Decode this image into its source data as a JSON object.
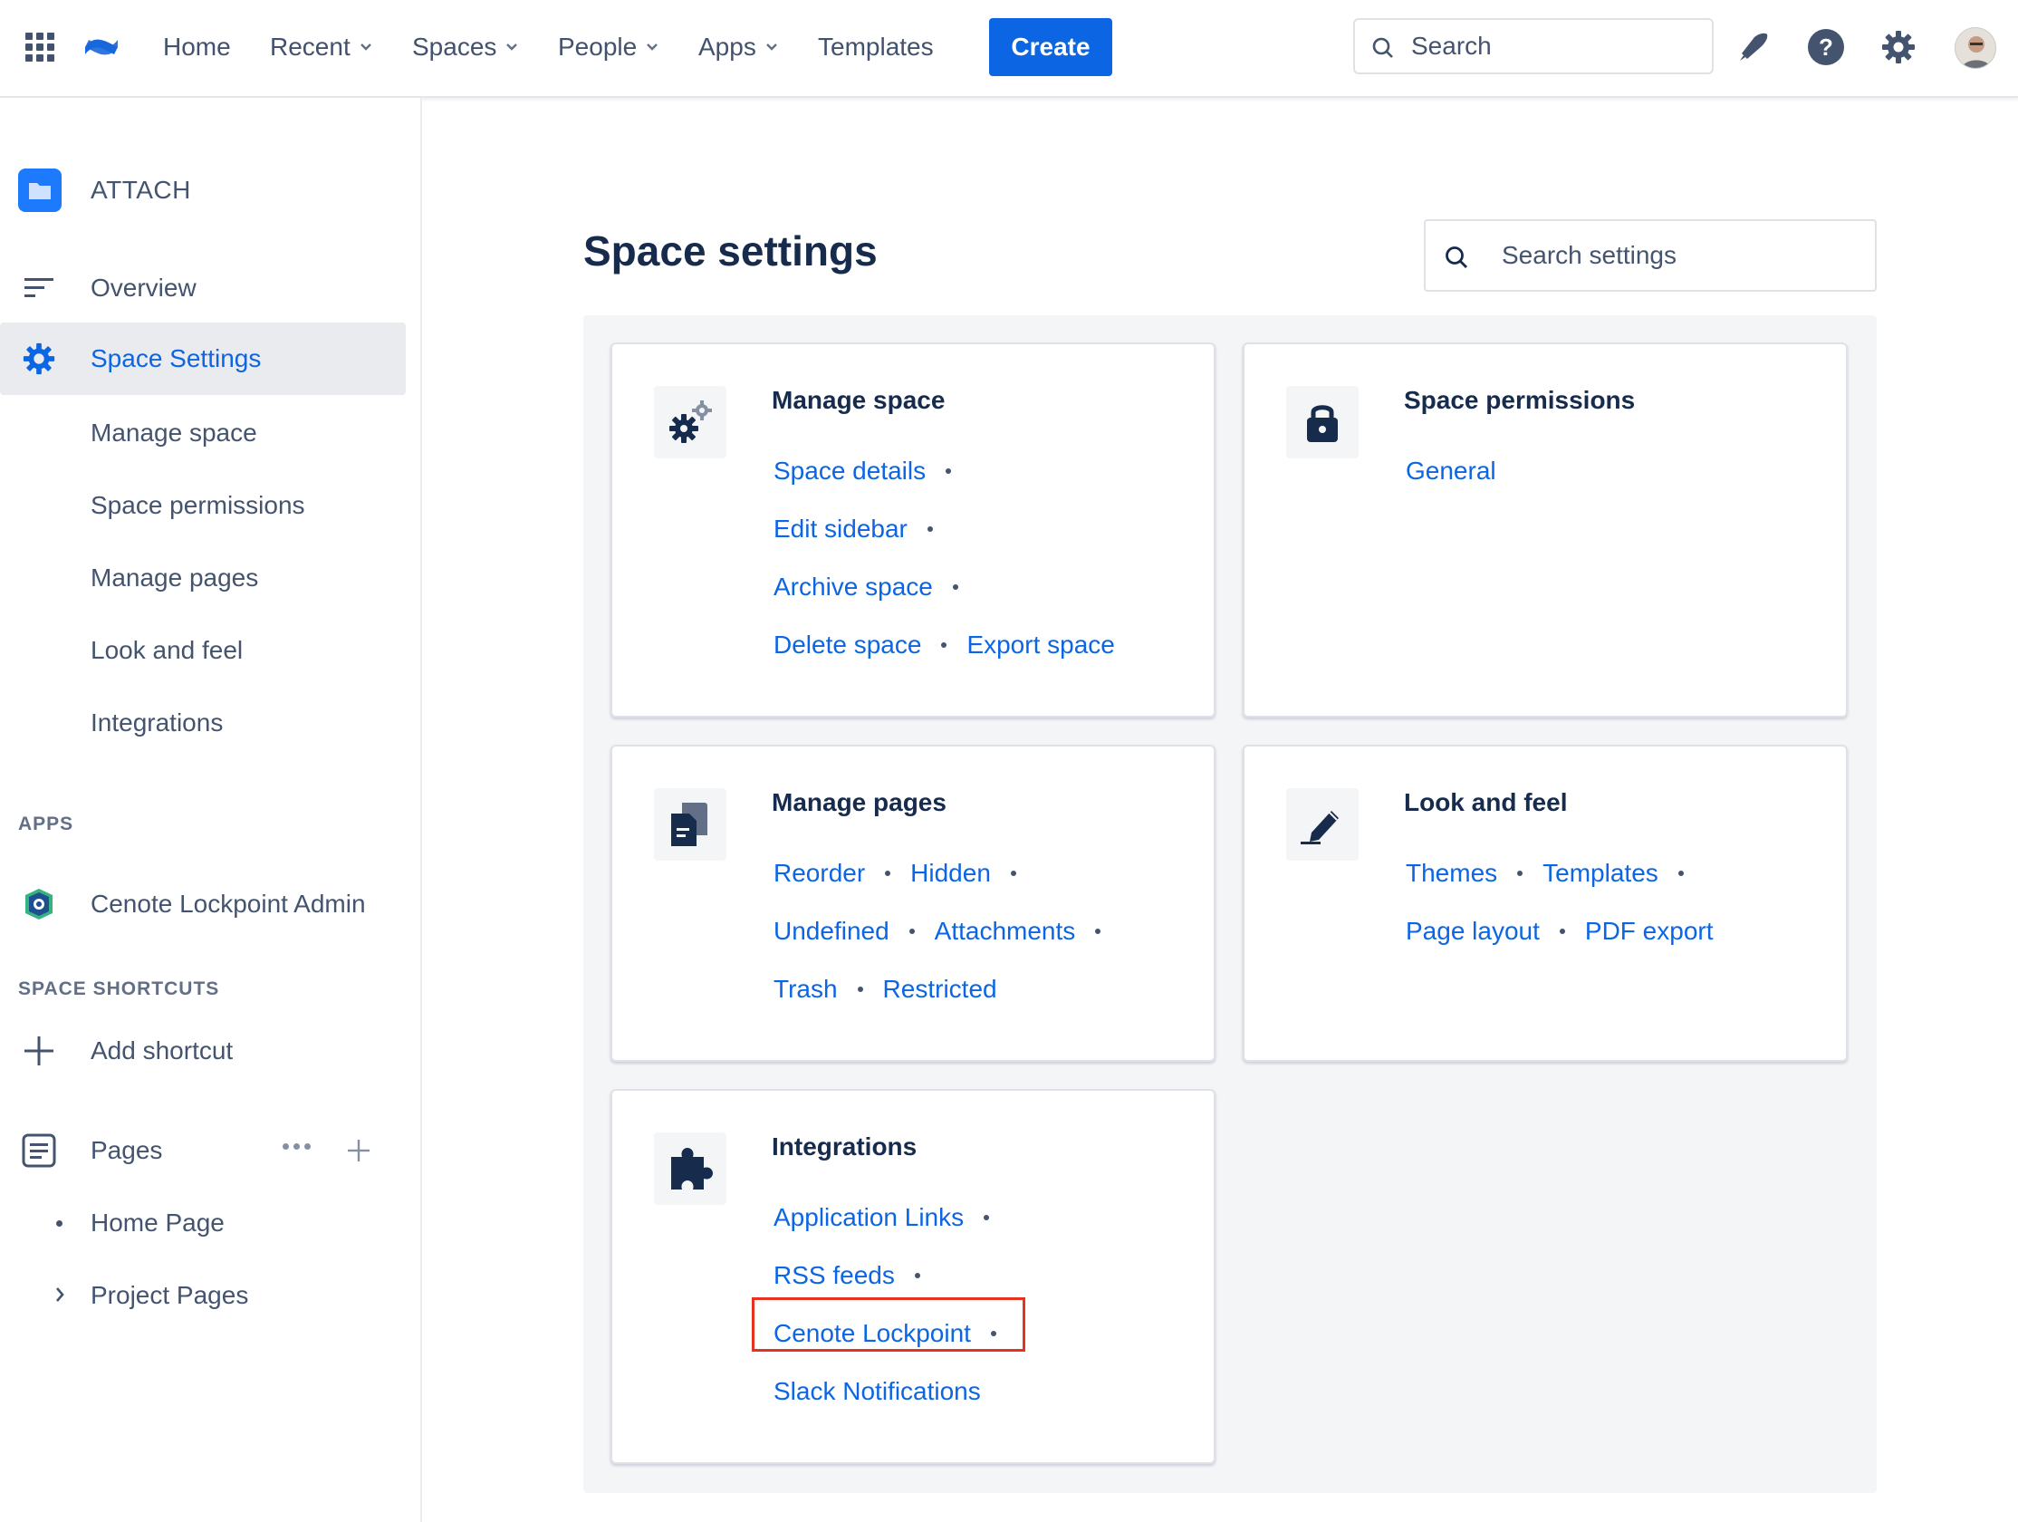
{
  "topnav": {
    "home": "Home",
    "recent": "Recent",
    "spaces": "Spaces",
    "people": "People",
    "apps": "Apps",
    "templates": "Templates",
    "create": "Create",
    "search_placeholder": "Search",
    "icons": [
      "app-switcher-icon",
      "confluence-logo-icon",
      "notifications-icon",
      "help-icon",
      "settings-icon",
      "avatar"
    ]
  },
  "sidebar": {
    "space_name": "ATTACH",
    "overview": "Overview",
    "space_settings": "Space Settings",
    "sub_items": [
      "Manage space",
      "Space permissions",
      "Manage pages",
      "Look and feel",
      "Integrations"
    ],
    "apps_heading": "APPS",
    "app_item": "Cenote Lockpoint Admin",
    "shortcuts_heading": "SPACE SHORTCUTS",
    "add_shortcut": "Add shortcut",
    "pages": "Pages",
    "page_items": [
      "Home Page",
      "Project Pages"
    ]
  },
  "main": {
    "title": "Space settings",
    "search_placeholder": "Search settings",
    "cards": {
      "manage_space": {
        "title": "Manage space",
        "links": [
          "Space details",
          "Edit sidebar",
          "Archive space",
          "Delete space",
          "Export space"
        ]
      },
      "permissions": {
        "title": "Space permissions",
        "links": [
          "General"
        ]
      },
      "manage_pages": {
        "title": "Manage pages",
        "links": [
          "Reorder",
          "Hidden",
          "Undefined",
          "Attachments",
          "Trash",
          "Restricted"
        ]
      },
      "look_feel": {
        "title": "Look and feel",
        "links": [
          "Themes",
          "Templates",
          "Page layout",
          "PDF export"
        ]
      },
      "integrations": {
        "title": "Integrations",
        "links": [
          "Application Links",
          "RSS feeds",
          "Cenote Lockpoint",
          "Slack Notifications"
        ]
      }
    }
  },
  "colors": {
    "accent": "#0c66e4",
    "highlight": "#e5331f",
    "text": "#172b4d",
    "muted": "#44546f"
  }
}
